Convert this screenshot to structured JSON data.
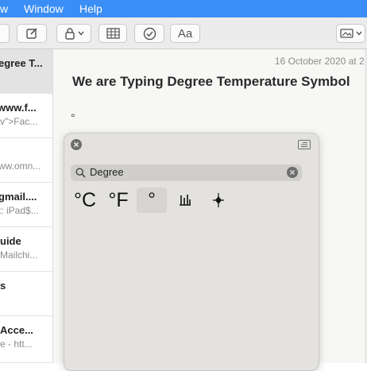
{
  "menubar": {
    "items": [
      "w",
      "Window",
      "Help"
    ]
  },
  "toolbar": {
    "format_button": "Aa"
  },
  "sidebar": {
    "notes": [
      {
        "title": "egree T...",
        "subtitle": ""
      },
      {
        "title": "www.f...",
        "subtitle": "v\">Fac..."
      },
      {
        "title": "",
        "subtitle": "ww.omn..."
      },
      {
        "title": "gmail....",
        "subtitle": "t: iPad$..."
      },
      {
        "title": "uide",
        "subtitle": "Mailchi..."
      },
      {
        "title": "s",
        "subtitle": ""
      },
      {
        "title": "Acce...",
        "subtitle": "e - htt..."
      }
    ]
  },
  "editor": {
    "date": "16 October 2020 at 2:",
    "heading": "We are Typing Degree Temperature Symbol",
    "typed_text": "°"
  },
  "character_viewer": {
    "search_query": "Degree",
    "results": [
      "°C",
      "°F",
      "°",
      "␛",
      "⟡"
    ],
    "selected_index": 2
  },
  "colors": {
    "menubar": "#3a8ef5",
    "toolbar": "#ececec",
    "viewer": "#e3e2df"
  }
}
